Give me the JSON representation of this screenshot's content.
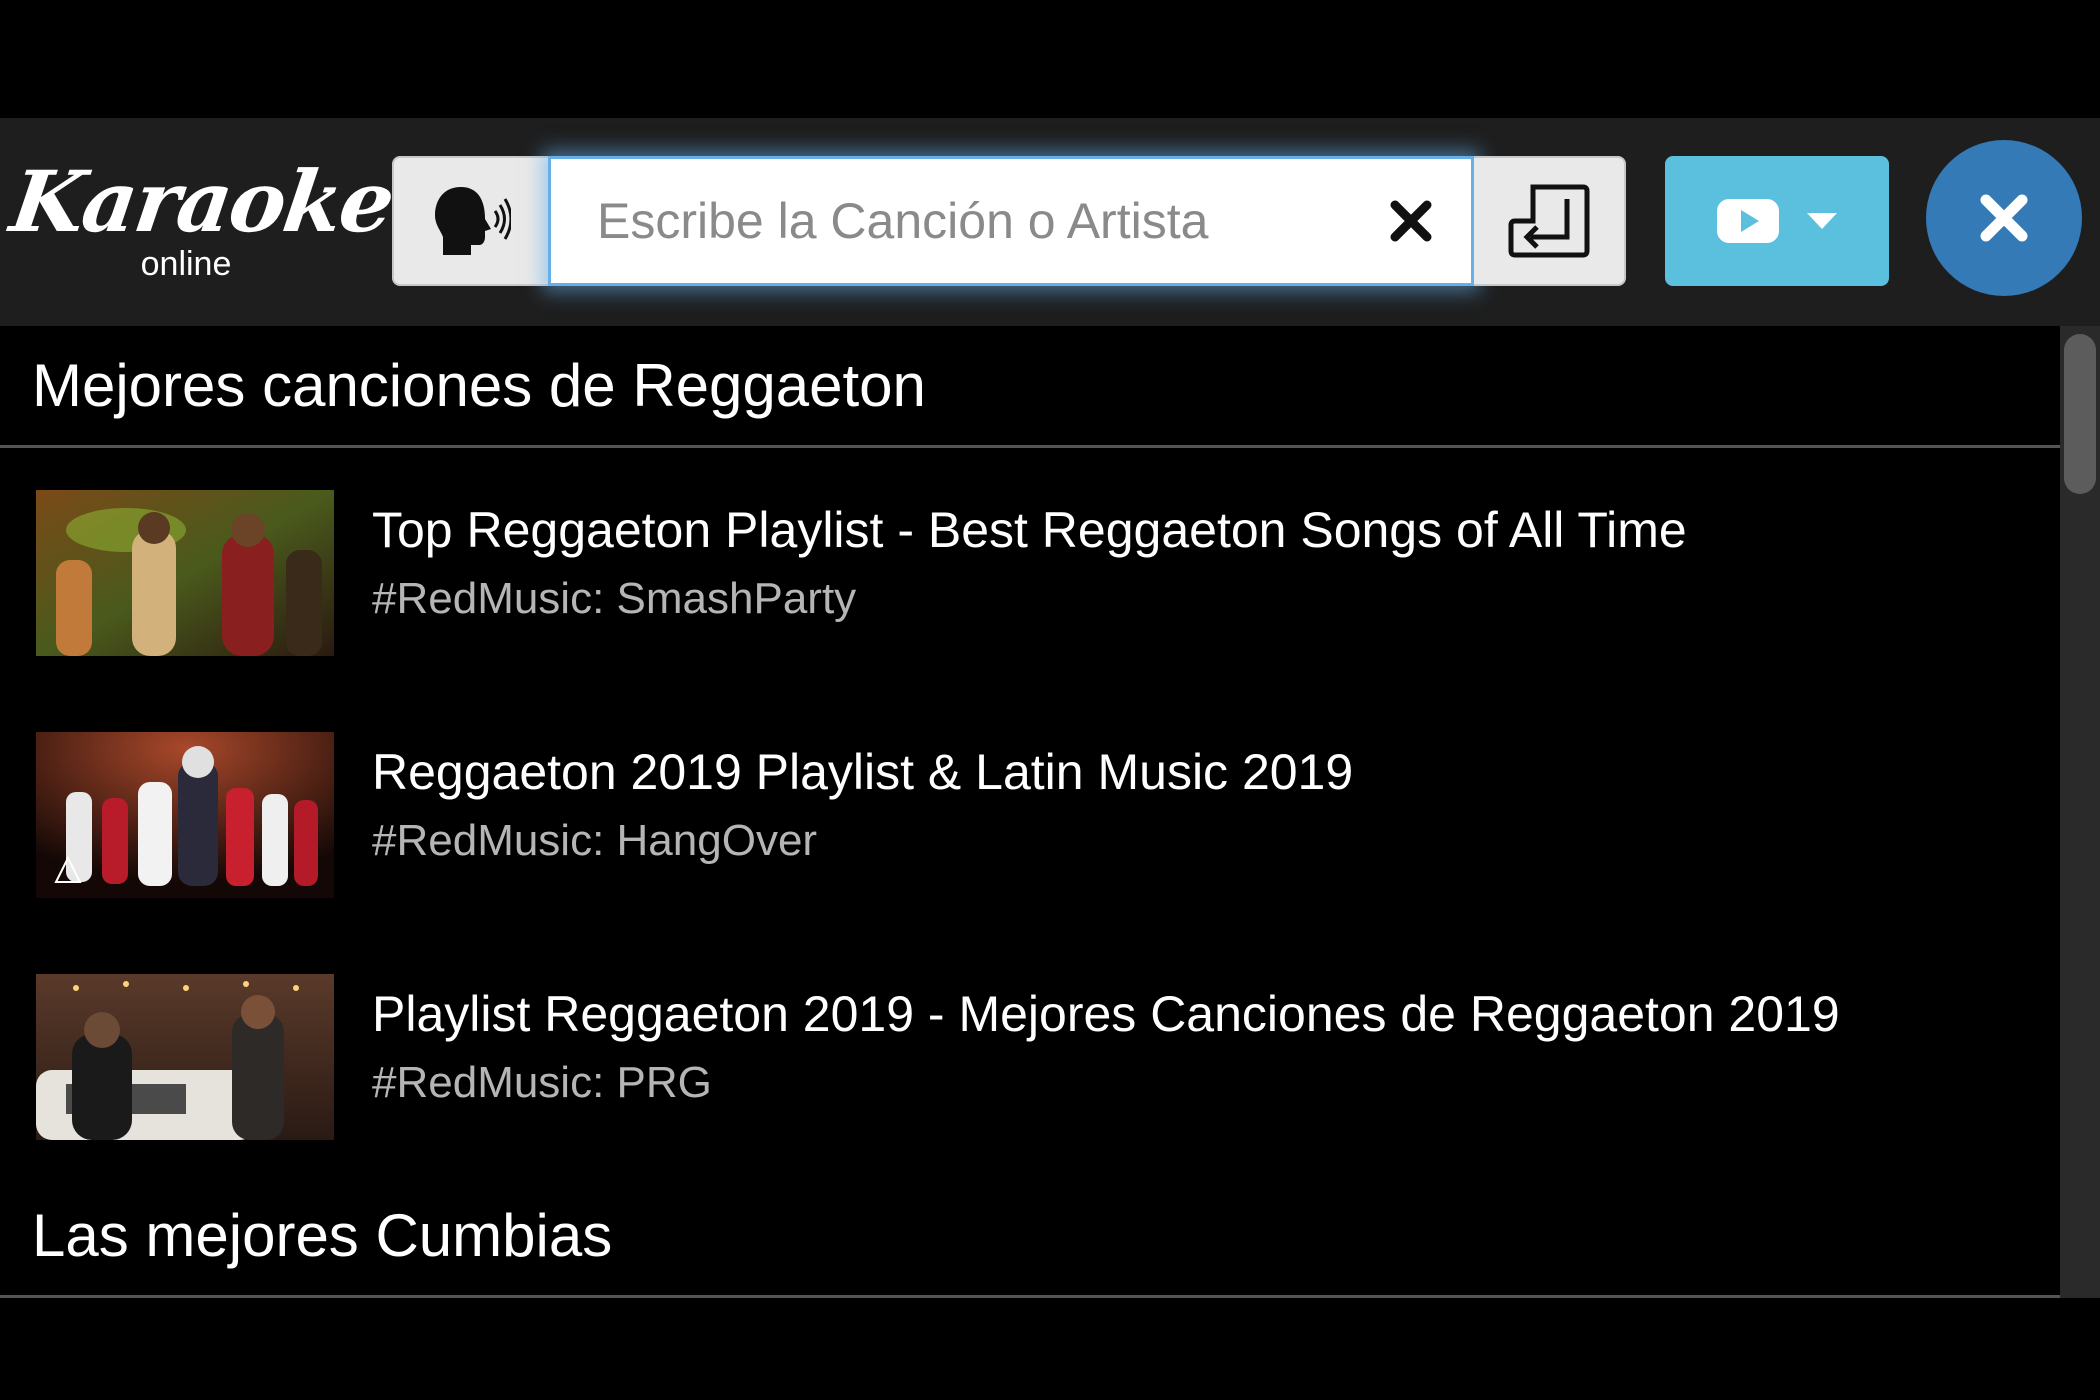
{
  "logo": {
    "title": "Karaoke",
    "subtitle": "online"
  },
  "search": {
    "placeholder": "Escribe la Canción o Artista",
    "value": ""
  },
  "toolbar": {
    "voice_icon": "speaking-head-icon",
    "clear_icon": "close-icon",
    "enter_icon": "enter-key-icon",
    "source_icon": "youtube-icon",
    "dropdown_icon": "caret-down-icon",
    "close_icon": "close-icon"
  },
  "colors": {
    "header_bg": "#1e1e1e",
    "source_button": "#5bc0de",
    "close_button": "#337ab7",
    "search_glow": "#66afe9"
  },
  "sections": [
    {
      "title": "Mejores canciones de Reggaeton",
      "items": [
        {
          "title": "Top Reggaeton Playlist - Best Reggaeton Songs of All Time",
          "channel": "#RedMusic: SmashParty"
        },
        {
          "title": "Reggaeton 2019 Playlist & Latin Music 2019",
          "channel": "#RedMusic: HangOver"
        },
        {
          "title": "Playlist Reggaeton 2019 - Mejores Canciones de Reggaeton 2019",
          "channel": "#RedMusic: PRG"
        }
      ]
    },
    {
      "title": "Las mejores Cumbias",
      "items": []
    }
  ]
}
